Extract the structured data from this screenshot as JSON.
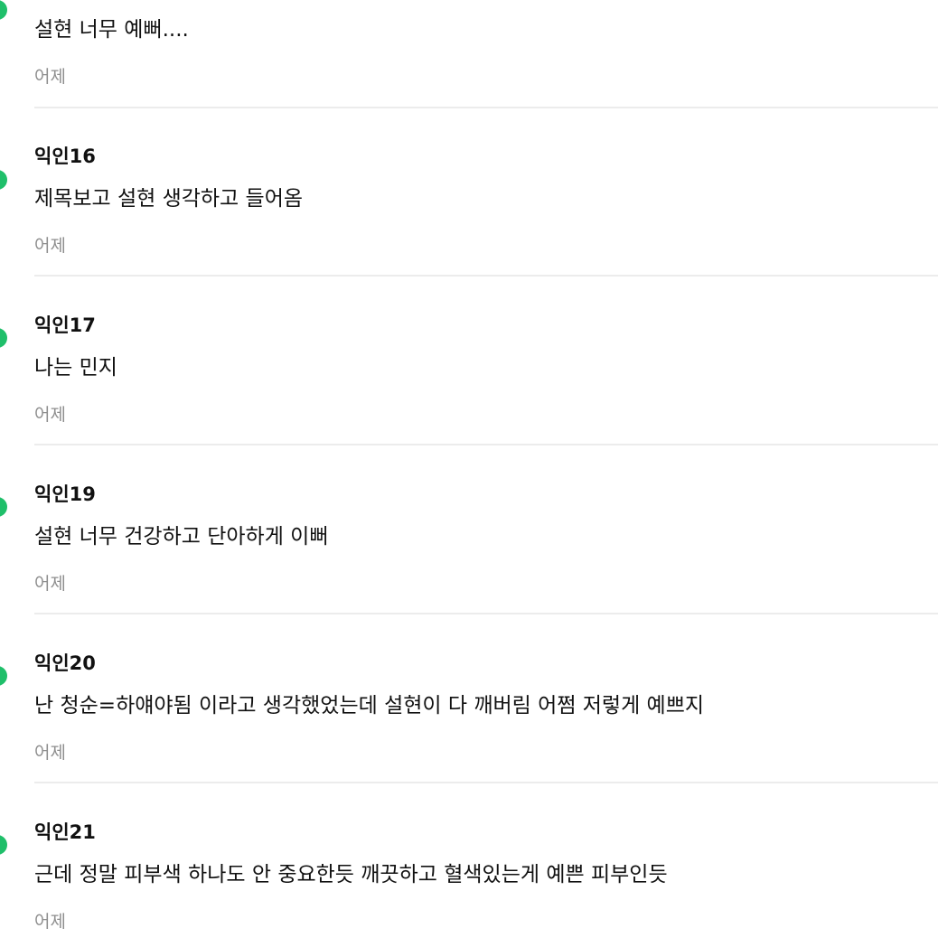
{
  "comments": [
    {
      "author": "",
      "text": "설현 너무 예뻐....",
      "time": "어제"
    },
    {
      "author": "익인16",
      "text": "제목보고 설현 생각하고 들어옴",
      "time": "어제"
    },
    {
      "author": "익인17",
      "text": "나는 민지",
      "time": "어제"
    },
    {
      "author": "익인19",
      "text": "설현 너무 건강하고 단아하게 이뻐",
      "time": "어제"
    },
    {
      "author": "익인20",
      "text": "난 청순=하얘야됨 이라고 생각했었는데 설현이 다 깨버림 어쩜 저렇게 예쁘지",
      "time": "어제"
    },
    {
      "author": "익인21",
      "text": "근데 정말 피부색 하나도 안 중요한듯 깨끗하고 혈색있는게 예쁜 피부인듯",
      "time": "어제"
    }
  ],
  "colors": {
    "accent": "#1fbf6a",
    "text": "#111111",
    "muted": "#8e8e8e",
    "divider": "#ececec"
  }
}
